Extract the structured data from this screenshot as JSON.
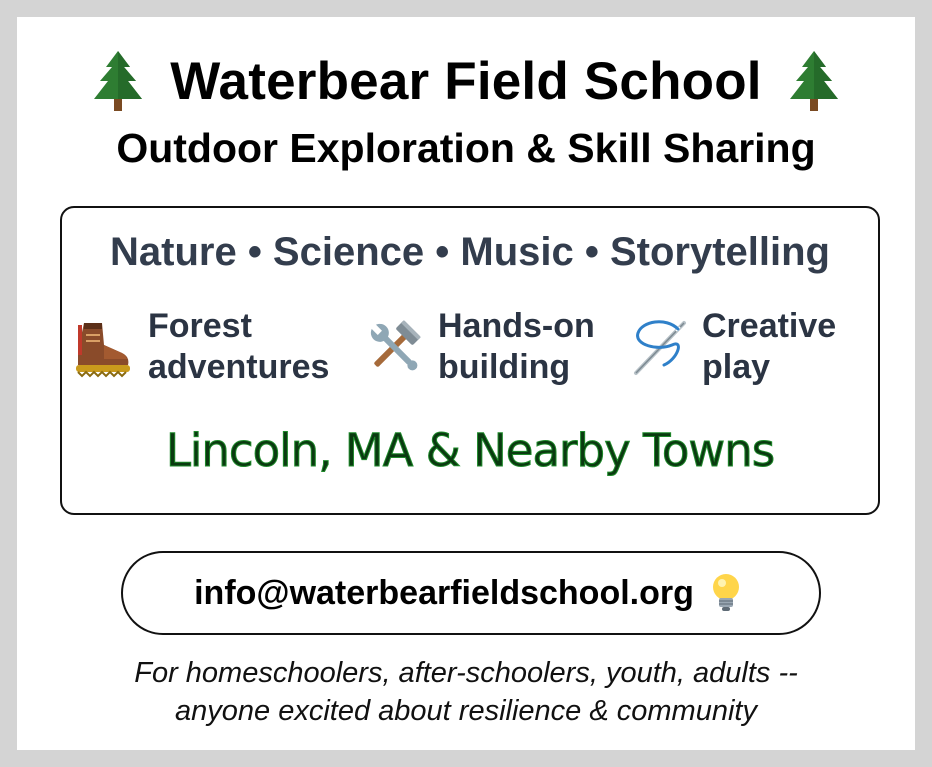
{
  "header": {
    "title": "Waterbear Field School",
    "subtitle": "Outdoor Exploration & Skill Sharing",
    "title_icon": "evergreen-tree-icon"
  },
  "panel": {
    "topics": "Nature • Science • Music • Storytelling",
    "features": [
      {
        "icon": "hiking-boot-icon",
        "line1": "Forest",
        "line2": "adventures"
      },
      {
        "icon": "hammer-wrench-icon",
        "line1": "Hands-on",
        "line2": "building"
      },
      {
        "icon": "needle-thread-icon",
        "line1": "Creative",
        "line2": "play"
      }
    ],
    "location": "Lincoln, MA & Nearby Towns"
  },
  "contact": {
    "email": "info@waterbearfieldschool.org",
    "icon": "lightbulb-icon"
  },
  "footer": {
    "line1": "For homeschoolers, after-schoolers, youth, adults --",
    "line2": "anyone excited about resilience & community"
  },
  "colors": {
    "background": "#d4d4d4",
    "card": "#ffffff",
    "topic_text": "#333d4d",
    "location_text": "#0a3a10",
    "tree_green": "#2e7d32"
  }
}
